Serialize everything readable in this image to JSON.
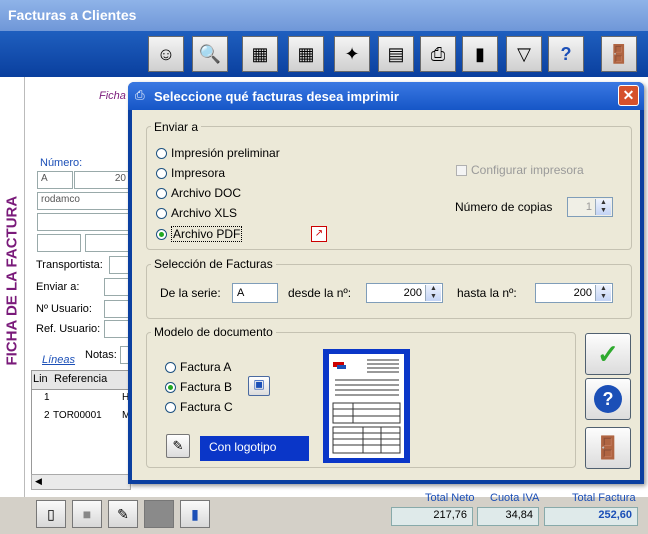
{
  "window": {
    "title": "Facturas a Clientes"
  },
  "toolbar": {
    "icons": [
      "person-icon",
      "magnifier-icon",
      "calculator-edit-icon",
      "calculator-edit-icon",
      "magic-wand-icon",
      "document-icon",
      "printer-icon",
      "book-icon",
      "filter-icon",
      "help-icon",
      "exit-door-icon"
    ]
  },
  "main": {
    "sidebar_title": "FICHA DE LA FACTURA",
    "ficha_label": "Ficha",
    "numero_label": "Número:",
    "serie_value": "A",
    "numero_value": "20",
    "cliente_value": "rodamco",
    "transportista_label": "Transportista:",
    "enviar_label": "Enviar a:",
    "usuario_label": "Nº Usuario:",
    "ref_usuario_label": "Ref. Usuario:",
    "lineas_label": "Líneas",
    "notas_label": "Notas:",
    "grid": {
      "headers": [
        "Lin",
        "Referencia"
      ],
      "rows": [
        [
          "1",
          "",
          "H"
        ],
        [
          "2",
          "TOR00001",
          "M"
        ]
      ]
    }
  },
  "totals": {
    "neto_label": "Total Neto",
    "neto_value": "217,76",
    "iva_label": "Cuota IVA",
    "iva_value": "34,84",
    "total_label": "Total Factura",
    "total_value": "252,60"
  },
  "dialog": {
    "title": "Seleccione qué facturas desea imprimir",
    "enviar": {
      "legend": "Enviar a",
      "options": [
        "Impresión preliminar",
        "Impresora",
        "Archivo DOC",
        "Archivo XLS",
        "Archivo PDF"
      ],
      "selected": "Archivo PDF",
      "configurar_label": "Configurar impresora",
      "copias_label": "Número de copias",
      "copias_value": "1"
    },
    "seleccion": {
      "legend": "Selección de Facturas",
      "serie_label": "De la serie:",
      "serie_value": "A",
      "desde_label": "desde la nº:",
      "desde_value": "200",
      "hasta_label": "hasta la nº:",
      "hasta_value": "200"
    },
    "modelo": {
      "legend": "Modelo de documento",
      "options": [
        "Factura A",
        "Factura B",
        "Factura C"
      ],
      "selected": "Factura B",
      "logo_label": "Con logotipo"
    }
  },
  "colors": {
    "accent": "#0b3fa0",
    "title": "#7a1a7a",
    "total_blue": "#1b4fb7"
  }
}
